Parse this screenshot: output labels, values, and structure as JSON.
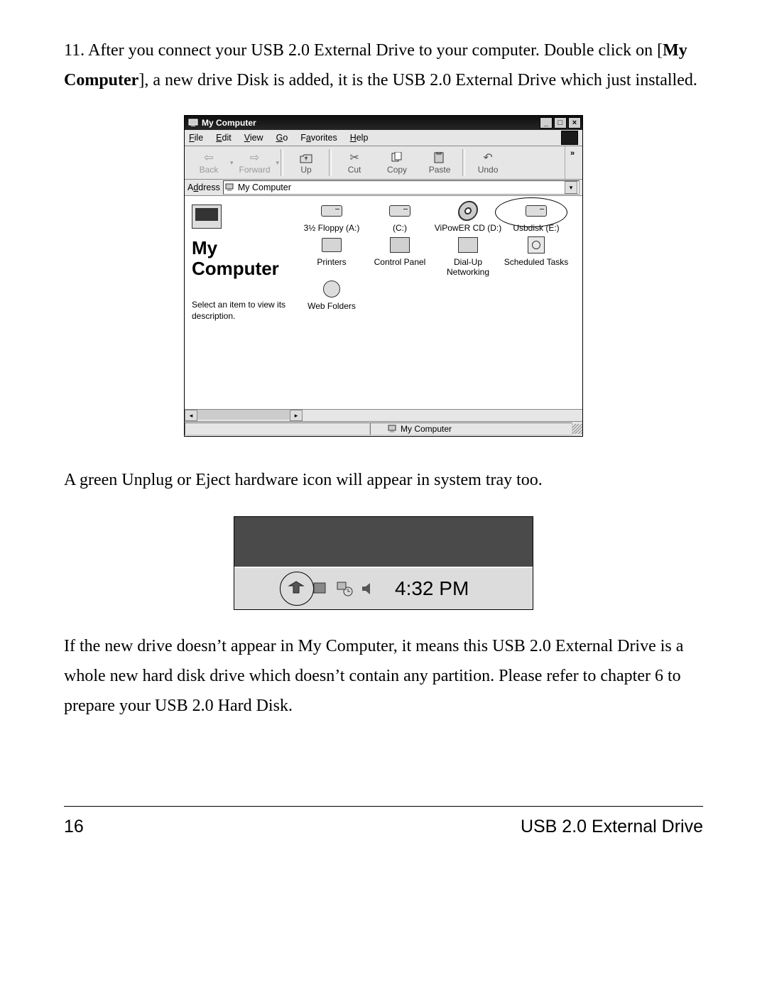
{
  "step": {
    "number": "11.",
    "text_a": "After you connect your USB 2.0 External Drive to your computer. Double click on [",
    "bold": "My Computer",
    "text_b": "], a new drive Disk is added, it is the USB 2.0 External Drive which just installed."
  },
  "window": {
    "title": "My Computer",
    "menus": [
      "File",
      "Edit",
      "View",
      "Go",
      "Favorites",
      "Help"
    ],
    "toolbar": {
      "back": "Back",
      "forward": "Forward",
      "up": "Up",
      "cut": "Cut",
      "copy": "Copy",
      "paste": "Paste",
      "undo": "Undo"
    },
    "address_label": "Address",
    "address_value": "My Computer",
    "side": {
      "title1": "My",
      "title2": "Computer",
      "desc": "Select an item to view its description."
    },
    "icons": [
      {
        "label": "3½ Floppy (A:)",
        "kind": "drive"
      },
      {
        "label": "(C:)",
        "kind": "drive"
      },
      {
        "label": "ViPowER CD (D:)",
        "kind": "cd"
      },
      {
        "label": "Usbdisk (E:)",
        "kind": "drive",
        "highlight": true
      },
      {
        "label": "Printers",
        "kind": "printer"
      },
      {
        "label": "Control Panel",
        "kind": "folder"
      },
      {
        "label": "Dial-Up Networking",
        "kind": "dial"
      },
      {
        "label": "Scheduled Tasks",
        "kind": "sched"
      },
      {
        "label": "Web Folders",
        "kind": "globe"
      }
    ],
    "status": "My Computer"
  },
  "tray_text": "A green Unplug or Eject hardware icon will appear in system tray too.",
  "tray": {
    "time": "4:32 PM"
  },
  "note": "If the new drive doesn’t appear in My Computer, it means this USB 2.0 External Drive is a whole new hard disk drive which doesn’t contain any partition. Please refer to chapter 6 to prepare your USB 2.0 Hard Disk.",
  "footer": {
    "page": "16",
    "title": "USB 2.0 External Drive"
  }
}
